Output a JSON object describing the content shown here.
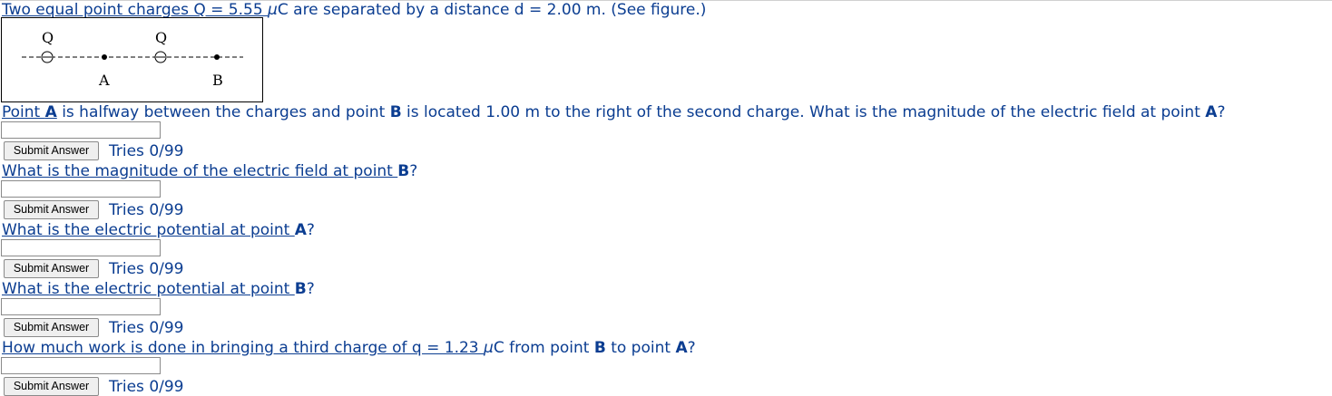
{
  "problem": {
    "intro": {
      "p1": "Two equal point charges Q = 5.55 ",
      "mu": "µ",
      "p2": "C are separated by a distance d = 2.00 m. (See figure.)"
    },
    "figure": {
      "charge_label_1": "Q",
      "charge_label_2": "Q",
      "point_a_label": "A",
      "point_b_label": "B"
    },
    "q1": {
      "p1": "Point ",
      "a": "A",
      "p2": " is halfway between the charges and point ",
      "b": "B",
      "p3": " is located 1.00 m to the right of the second charge. What is the magnitude of the electric field at point ",
      "a2": "A",
      "p4": "?"
    },
    "q2": {
      "p1": "What is the magnitude of the electric field at point ",
      "b": "B",
      "p2": "?"
    },
    "q3": {
      "p1": "What is the electric potential at point ",
      "a": "A",
      "p2": "?"
    },
    "q4": {
      "p1": "What is the electric potential at point ",
      "b": "B",
      "p2": "?"
    },
    "q5": {
      "p1": "How much work is done in bringing a third charge of q = 1.23 ",
      "mu": "µ",
      "p2": "C from point ",
      "b": "B",
      "p3": " to point ",
      "a": "A",
      "p4": "?"
    }
  },
  "controls": {
    "submit_label": "Submit Answer",
    "tries": [
      "Tries 0/99",
      "Tries 0/99",
      "Tries 0/99",
      "Tries 0/99",
      "Tries 0/99"
    ],
    "answers": [
      "",
      "",
      "",
      "",
      ""
    ]
  }
}
